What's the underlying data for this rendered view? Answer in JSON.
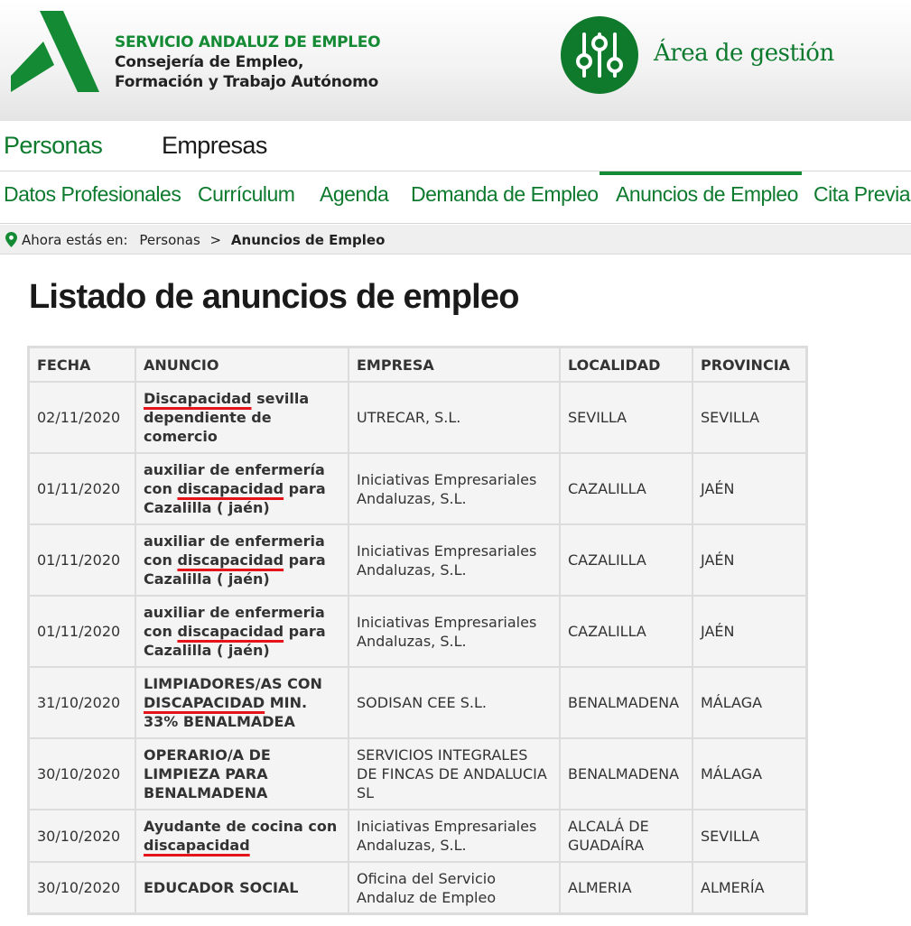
{
  "header": {
    "org_line1": "SERVICIO ANDALUZ DE EMPLEO",
    "org_line2": "Consejería de Empleo,",
    "org_line3": "Formación y Trabajo Autónomo",
    "area_title": "Área de gestión",
    "brand_green": "#138a33",
    "logo_icon": "andalucia-a-logo",
    "area_icon": "sliders-icon"
  },
  "top_tabs": [
    {
      "label": "Personas",
      "active": true
    },
    {
      "label": "Empresas",
      "active": false
    }
  ],
  "sub_tabs": [
    {
      "label": "Datos Profesionales"
    },
    {
      "label": "Currículum"
    },
    {
      "label": "Agenda"
    },
    {
      "label": "Demanda de Empleo"
    },
    {
      "label": "Anuncios de Empleo",
      "active": true
    },
    {
      "label": "Cita Previa"
    }
  ],
  "breadcrumb": {
    "prefix": "Ahora estás en:",
    "parent": "Personas",
    "separator": ">",
    "current": "Anuncios de Empleo"
  },
  "page_title": "Listado de anuncios de empleo",
  "table": {
    "headers": [
      "FECHA",
      "ANUNCIO",
      "EMPRESA",
      "LOCALIDAD",
      "PROVINCIA"
    ],
    "highlight_color": "#e5141b",
    "rows": [
      {
        "fecha": "02/11/2020",
        "anuncio_pre": "",
        "anuncio_hl": "Discapacidad",
        "anuncio_post": " sevilla dependiente de comercio",
        "empresa": "UTRECAR, S.L.",
        "localidad": "SEVILLA",
        "provincia": "SEVILLA"
      },
      {
        "fecha": "01/11/2020",
        "anuncio_pre": "auxiliar de enfermería con ",
        "anuncio_hl": "discapacidad",
        "anuncio_post": " para Cazalilla ( jaén)",
        "empresa": "Iniciativas Empresariales Andaluzas, S.L.",
        "localidad": "CAZALILLA",
        "provincia": "JAÉN"
      },
      {
        "fecha": "01/11/2020",
        "anuncio_pre": "auxiliar de enfermeria con ",
        "anuncio_hl": "discapacidad",
        "anuncio_post": " para Cazalilla ( jaén)",
        "empresa": "Iniciativas Empresariales Andaluzas, S.L.",
        "localidad": "CAZALILLA",
        "provincia": "JAÉN"
      },
      {
        "fecha": "01/11/2020",
        "anuncio_pre": "auxiliar de enfermeria con ",
        "anuncio_hl": "discapacidad",
        "anuncio_post": " para Cazalilla ( jaén)",
        "empresa": "Iniciativas Empresariales Andaluzas, S.L.",
        "localidad": "CAZALILLA",
        "provincia": "JAÉN"
      },
      {
        "fecha": "31/10/2020",
        "anuncio_pre": "LIMPIADORES/AS CON ",
        "anuncio_hl": "DISCAPACIDAD",
        "anuncio_post": " MIN. 33% BENALMADEA",
        "empresa": "SODISAN CEE S.L.",
        "localidad": "BENALMADENA",
        "provincia": "MÁLAGA"
      },
      {
        "fecha": "30/10/2020",
        "anuncio_pre": "OPERARIO/A DE LIMPIEZA PARA BENALMADENA",
        "anuncio_hl": "",
        "anuncio_post": "",
        "empresa": "SERVICIOS INTEGRALES DE FINCAS DE ANDALUCIA SL",
        "localidad": "BENALMADENA",
        "provincia": "MÁLAGA"
      },
      {
        "fecha": "30/10/2020",
        "anuncio_pre": "Ayudante de cocina con ",
        "anuncio_hl": "discapacidad",
        "anuncio_post": "",
        "empresa": "Iniciativas Empresariales Andaluzas, S.L.",
        "localidad": "ALCALÁ DE GUADAÍRA",
        "provincia": "SEVILLA"
      },
      {
        "fecha": "30/10/2020",
        "anuncio_pre": "EDUCADOR SOCIAL",
        "anuncio_hl": "",
        "anuncio_post": "",
        "empresa": "Oficina del Servicio Andaluz de Empleo",
        "localidad": "ALMERIA",
        "provincia": "ALMERÍA"
      }
    ]
  }
}
